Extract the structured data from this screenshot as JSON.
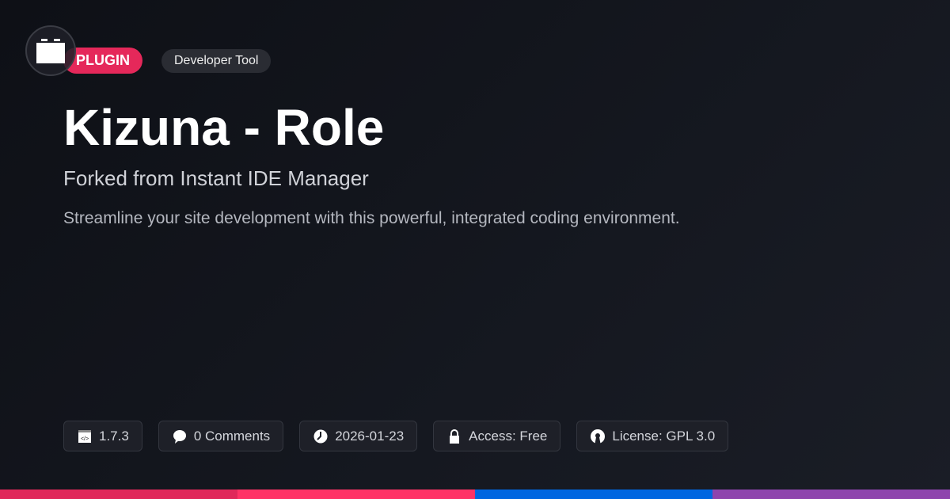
{
  "badge": "PLUGIN",
  "category": "Developer Tool",
  "title": "Kizuna - Role",
  "subtitle": "Forked from Instant IDE Manager",
  "description": "Streamline your site development with this powerful, integrated coding environment.",
  "meta": {
    "version": "1.7.3",
    "comments": "0 Comments",
    "date": "2026-01-23",
    "access": "Access: Free",
    "license": "License: GPL 3.0"
  },
  "colors": {
    "bar": [
      "#e0285a",
      "#ff3366",
      "#0066e0",
      "#8e44ad"
    ]
  }
}
